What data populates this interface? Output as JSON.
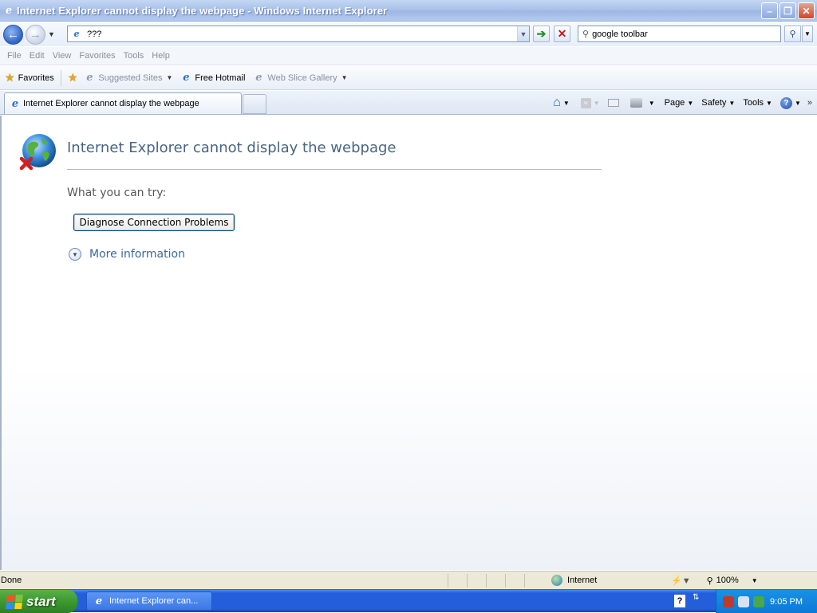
{
  "window": {
    "title": "Internet Explorer cannot display the webpage - Windows Internet Explorer"
  },
  "address_bar": {
    "url": "???"
  },
  "search": {
    "value": "google toolbar"
  },
  "menu": {
    "items": [
      "File",
      "Edit",
      "View",
      "Favorites",
      "Tools",
      "Help"
    ]
  },
  "favorites_bar": {
    "favorites_label": "Favorites",
    "links": [
      {
        "label": "Suggested Sites"
      },
      {
        "label": "Free Hotmail"
      },
      {
        "label": "Web Slice Gallery"
      }
    ]
  },
  "tabs": {
    "active_label": "Internet Explorer cannot display the webpage"
  },
  "command_bar": {
    "page_label": "Page",
    "safety_label": "Safety",
    "tools_label": "Tools"
  },
  "content": {
    "heading": "Internet Explorer cannot display the webpage",
    "try_label": "What you can try:",
    "diagnose_label": "Diagnose Connection Problems",
    "more_info_label": "More information"
  },
  "status_bar": {
    "status": "Done",
    "zone": "Internet",
    "zoom": "100%"
  },
  "taskbar": {
    "start_label": "start",
    "task_label": "Internet Explorer can...",
    "clock": "9:05 PM"
  },
  "colors": {
    "heading": "#4a6583",
    "link": "#3a6a9a",
    "taskbar": "#245edb",
    "start": "#3c9a2f"
  }
}
